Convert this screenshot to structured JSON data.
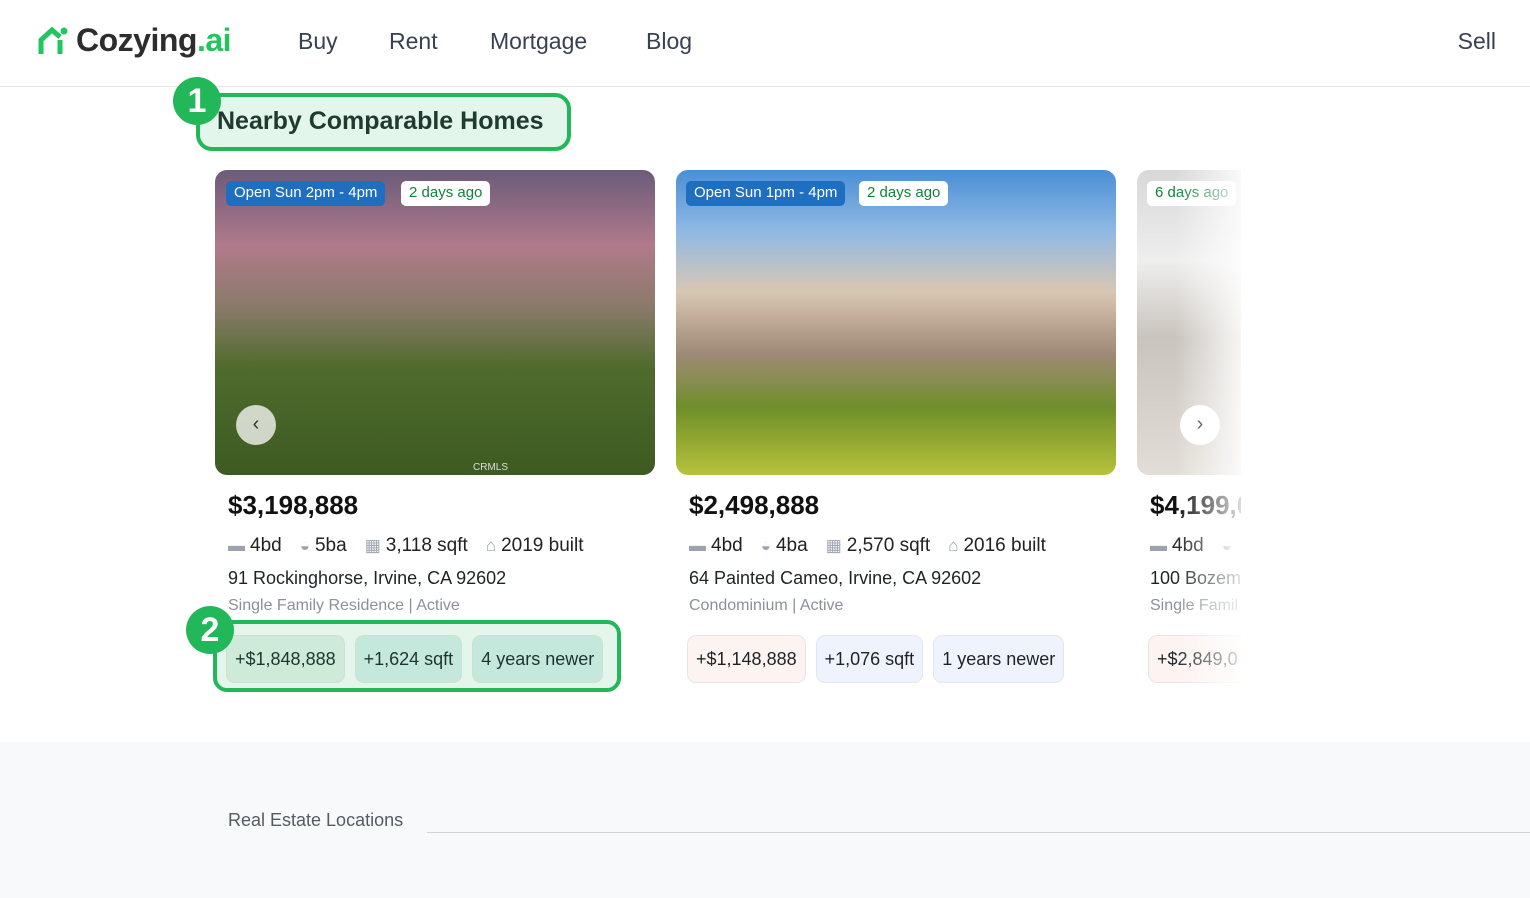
{
  "header": {
    "logo_main": "Cozying",
    "logo_suffix": ".ai",
    "nav": [
      "Buy",
      "Rent",
      "Mortgage",
      "Blog"
    ],
    "sell": "Sell"
  },
  "section": {
    "title": "Nearby Comparable Homes",
    "marker1": "1",
    "marker2": "2"
  },
  "cards": [
    {
      "open_house": "Open Sun 2pm - 4pm",
      "age": "2 days ago",
      "watermark": "CRMLS",
      "price": "$3,198,888",
      "beds": "4bd",
      "baths": "5ba",
      "sqft": "3,118 sqft",
      "built": "2019 built",
      "address": "91 Rockinghorse, Irvine, CA 92602",
      "type": "Single Family Residence | Active",
      "diff_price": "+$1,848,888",
      "diff_sqft": "+1,624 sqft",
      "diff_age": "4 years newer"
    },
    {
      "open_house": "Open Sun 1pm - 4pm",
      "age": "2 days ago",
      "price": "$2,498,888",
      "beds": "4bd",
      "baths": "4ba",
      "sqft": "2,570 sqft",
      "built": "2016 built",
      "address": "64 Painted Cameo, Irvine, CA 92602",
      "type": "Condominium | Active",
      "diff_price": "+$1,148,888",
      "diff_sqft": "+1,076 sqft",
      "diff_age": "1 years newer"
    },
    {
      "age": "6 days ago",
      "price": "$4,199,0",
      "beds": "4bd",
      "address": "100 Bozem",
      "type": "Single Famil",
      "diff_price": "+$2,849,0"
    }
  ],
  "icons": {
    "prev": "chevron-left-icon",
    "next": "chevron-right-icon",
    "bed": "bed-icon",
    "bath": "bathtub-icon",
    "sqft": "grid-icon",
    "built": "house-icon"
  },
  "footer": {
    "label": "Real Estate Locations"
  },
  "colors": {
    "accent": "#22b85a",
    "open_tag": "#1e6fbf"
  }
}
